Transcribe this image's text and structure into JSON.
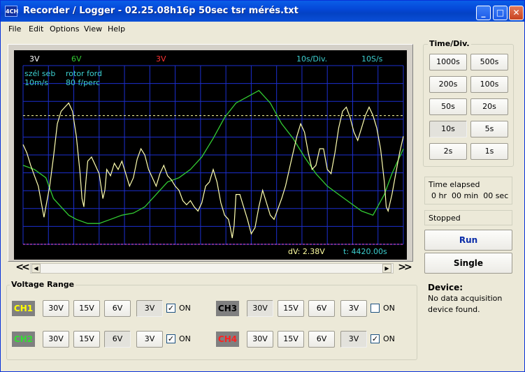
{
  "window": {
    "icon_text": "4CH",
    "title": "Recorder / Logger - 02.25.08h16p 50sec tsr mérés.txt"
  },
  "title_buttons": {
    "minimize": "_",
    "maximize": "□",
    "close": "✕"
  },
  "menu": [
    "File",
    "Edit",
    "Options",
    "View",
    "Help"
  ],
  "scope": {
    "top_labels": {
      "ch1_range": "3V",
      "ch2_range": "6V",
      "ch4_range": "3V",
      "time_div": "10s/Div.",
      "rate": "10S/s"
    },
    "legend": {
      "ch1_name": "szél seb",
      "ch1_scale": "10m/s",
      "ch2_name": "rotor ford",
      "ch2_scale": "80 f/perc"
    },
    "readout_dv": "dV: 2.38V",
    "readout_t": "t: 4420.00s",
    "colors": {
      "background": "#000000",
      "grid": "#1c2fd0",
      "ch1": "#ffffb0",
      "ch2": "#33cc33",
      "ch4": "#ff3333",
      "cyan_text": "#3ccfcf",
      "cursor_line": "#ffffa0",
      "marker_line": "#ff5aff"
    },
    "traces": {
      "ch1": [
        [
          0.0,
          0.42
        ],
        [
          0.01,
          0.38
        ],
        [
          0.02,
          0.32
        ],
        [
          0.03,
          0.27
        ],
        [
          0.04,
          0.22
        ],
        [
          0.05,
          0.12
        ],
        [
          0.055,
          0.07
        ],
        [
          0.06,
          0.12
        ],
        [
          0.07,
          0.22
        ],
        [
          0.08,
          0.36
        ],
        [
          0.09,
          0.52
        ],
        [
          0.1,
          0.58
        ],
        [
          0.11,
          0.6
        ],
        [
          0.12,
          0.62
        ],
        [
          0.13,
          0.58
        ],
        [
          0.14,
          0.46
        ],
        [
          0.15,
          0.28
        ],
        [
          0.155,
          0.16
        ],
        [
          0.16,
          0.12
        ],
        [
          0.165,
          0.24
        ],
        [
          0.17,
          0.34
        ],
        [
          0.18,
          0.36
        ],
        [
          0.19,
          0.32
        ],
        [
          0.2,
          0.28
        ],
        [
          0.21,
          0.16
        ],
        [
          0.215,
          0.2
        ],
        [
          0.22,
          0.3
        ],
        [
          0.23,
          0.27
        ],
        [
          0.24,
          0.33
        ],
        [
          0.25,
          0.3
        ],
        [
          0.26,
          0.34
        ],
        [
          0.27,
          0.28
        ],
        [
          0.28,
          0.22
        ],
        [
          0.29,
          0.26
        ],
        [
          0.3,
          0.35
        ],
        [
          0.31,
          0.4
        ],
        [
          0.32,
          0.37
        ],
        [
          0.33,
          0.3
        ],
        [
          0.34,
          0.26
        ],
        [
          0.35,
          0.22
        ],
        [
          0.36,
          0.28
        ],
        [
          0.37,
          0.32
        ],
        [
          0.38,
          0.27
        ],
        [
          0.39,
          0.25
        ],
        [
          0.4,
          0.22
        ],
        [
          0.41,
          0.2
        ],
        [
          0.42,
          0.15
        ],
        [
          0.43,
          0.13
        ],
        [
          0.44,
          0.15
        ],
        [
          0.45,
          0.12
        ],
        [
          0.46,
          0.1
        ],
        [
          0.47,
          0.14
        ],
        [
          0.48,
          0.22
        ],
        [
          0.49,
          0.24
        ],
        [
          0.5,
          0.3
        ],
        [
          0.51,
          0.24
        ],
        [
          0.52,
          0.14
        ],
        [
          0.53,
          0.08
        ],
        [
          0.54,
          0.06
        ],
        [
          0.545,
          0.02
        ],
        [
          0.55,
          -0.03
        ],
        [
          0.555,
          0.03
        ],
        [
          0.56,
          0.18
        ],
        [
          0.57,
          0.18
        ],
        [
          0.58,
          0.12
        ],
        [
          0.59,
          0.06
        ],
        [
          0.6,
          -0.01
        ],
        [
          0.61,
          0.02
        ],
        [
          0.62,
          0.12
        ],
        [
          0.63,
          0.2
        ],
        [
          0.64,
          0.14
        ],
        [
          0.65,
          0.08
        ],
        [
          0.66,
          0.06
        ],
        [
          0.67,
          0.11
        ],
        [
          0.68,
          0.16
        ],
        [
          0.69,
          0.22
        ],
        [
          0.7,
          0.3
        ],
        [
          0.71,
          0.38
        ],
        [
          0.72,
          0.46
        ],
        [
          0.73,
          0.52
        ],
        [
          0.74,
          0.48
        ],
        [
          0.75,
          0.38
        ],
        [
          0.76,
          0.3
        ],
        [
          0.77,
          0.32
        ],
        [
          0.78,
          0.4
        ],
        [
          0.79,
          0.4
        ],
        [
          0.8,
          0.3
        ],
        [
          0.81,
          0.28
        ],
        [
          0.82,
          0.38
        ],
        [
          0.83,
          0.5
        ],
        [
          0.84,
          0.58
        ],
        [
          0.85,
          0.6
        ],
        [
          0.86,
          0.55
        ],
        [
          0.87,
          0.48
        ],
        [
          0.88,
          0.44
        ],
        [
          0.89,
          0.5
        ],
        [
          0.9,
          0.56
        ],
        [
          0.91,
          0.6
        ],
        [
          0.92,
          0.56
        ],
        [
          0.93,
          0.5
        ],
        [
          0.94,
          0.4
        ],
        [
          0.95,
          0.24
        ],
        [
          0.955,
          0.12
        ],
        [
          0.96,
          0.1
        ],
        [
          0.97,
          0.18
        ],
        [
          0.98,
          0.28
        ],
        [
          0.99,
          0.38
        ],
        [
          1.0,
          0.46
        ]
      ],
      "ch2": [
        [
          0.0,
          0.32
        ],
        [
          0.03,
          0.3
        ],
        [
          0.06,
          0.26
        ],
        [
          0.08,
          0.16
        ],
        [
          0.1,
          0.12
        ],
        [
          0.12,
          0.08
        ],
        [
          0.14,
          0.06
        ],
        [
          0.17,
          0.04
        ],
        [
          0.2,
          0.04
        ],
        [
          0.23,
          0.06
        ],
        [
          0.26,
          0.08
        ],
        [
          0.29,
          0.09
        ],
        [
          0.32,
          0.12
        ],
        [
          0.35,
          0.18
        ],
        [
          0.38,
          0.24
        ],
        [
          0.41,
          0.26
        ],
        [
          0.44,
          0.3
        ],
        [
          0.47,
          0.36
        ],
        [
          0.5,
          0.45
        ],
        [
          0.53,
          0.55
        ],
        [
          0.56,
          0.62
        ],
        [
          0.59,
          0.65
        ],
        [
          0.62,
          0.68
        ],
        [
          0.65,
          0.62
        ],
        [
          0.68,
          0.52
        ],
        [
          0.71,
          0.45
        ],
        [
          0.74,
          0.36
        ],
        [
          0.77,
          0.28
        ],
        [
          0.8,
          0.22
        ],
        [
          0.83,
          0.18
        ],
        [
          0.86,
          0.14
        ],
        [
          0.89,
          0.1
        ],
        [
          0.92,
          0.08
        ],
        [
          0.95,
          0.18
        ],
        [
          0.97,
          0.28
        ],
        [
          1.0,
          0.4
        ]
      ]
    }
  },
  "scrollbar": {
    "left_jump": "<<",
    "right_jump": ">>",
    "left_arrow": "◀",
    "right_arrow": "▶"
  },
  "time_div": {
    "title": "Time/Div.",
    "buttons": [
      "1000s",
      "500s",
      "200s",
      "100s",
      "50s",
      "20s",
      "10s",
      "5s",
      "2s",
      "1s"
    ],
    "selected": "10s"
  },
  "time_elapsed": {
    "label": "Time elapsed",
    "value": "0 hr  00 min  00 sec"
  },
  "status": "Stopped",
  "controls": {
    "run": "Run",
    "single": "Single"
  },
  "device": {
    "title": "Device:",
    "message_line1": "No data acquisition",
    "message_line2": "device found."
  },
  "voltage_range": {
    "title": "Voltage Range",
    "options": [
      "30V",
      "15V",
      "6V",
      "3V"
    ],
    "on_label": "ON",
    "channels": [
      {
        "id": "CH1",
        "color": "#ffff00",
        "selected": "3V",
        "on": true,
        "check_mark": "✓"
      },
      {
        "id": "CH2",
        "color": "#33dd33",
        "selected": "6V",
        "on": true,
        "check_mark": "✓"
      },
      {
        "id": "CH3",
        "color": "#000000",
        "selected": "30V",
        "on": false,
        "check_mark": ""
      },
      {
        "id": "CH4",
        "color": "#ff2020",
        "selected": "3V",
        "on": true,
        "check_mark": "✓"
      }
    ]
  }
}
